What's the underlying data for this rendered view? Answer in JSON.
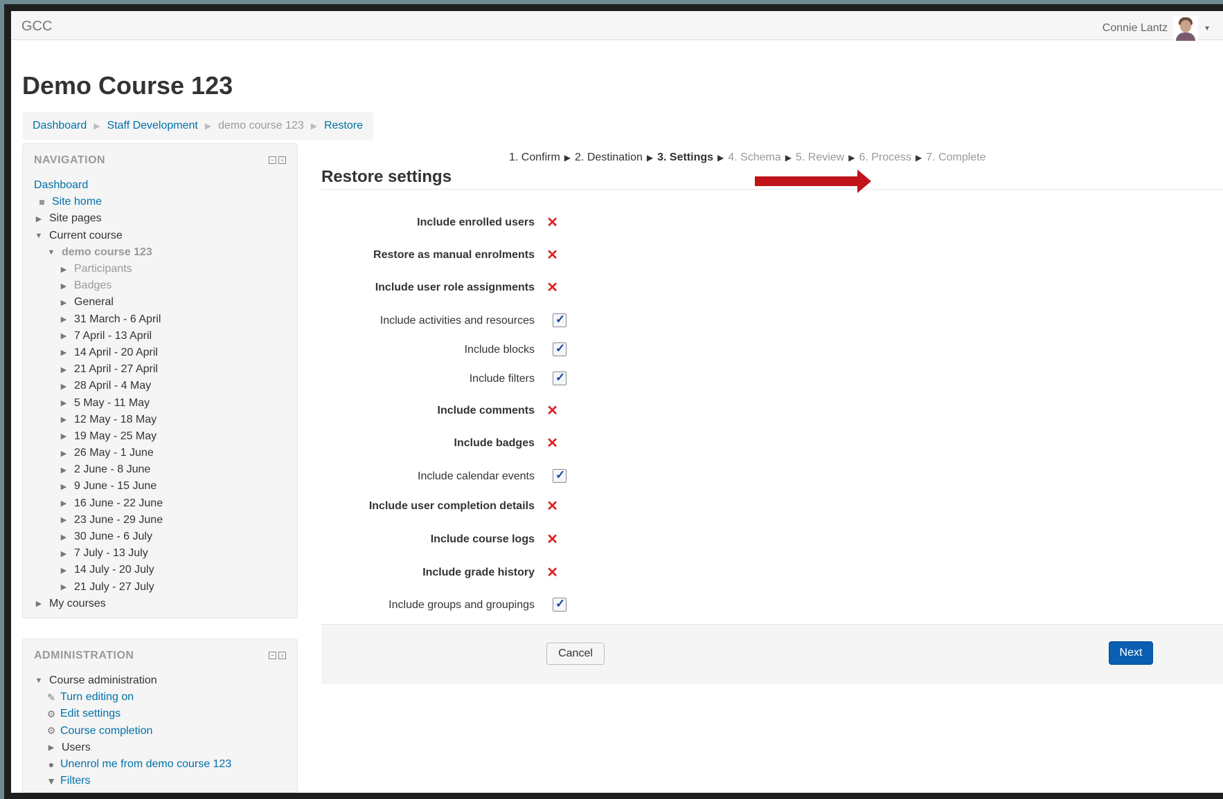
{
  "topbar": {
    "brand": "GCC",
    "user_name": "Connie Lantz"
  },
  "page": {
    "title": "Demo Course 123"
  },
  "breadcrumb": [
    {
      "label": "Dashboard",
      "current": false
    },
    {
      "label": "Staff Development",
      "current": false
    },
    {
      "label": "demo course 123",
      "current": true
    },
    {
      "label": "Restore",
      "current": false
    }
  ],
  "steps": [
    {
      "label": "1. Confirm",
      "state": "done"
    },
    {
      "label": "2. Destination",
      "state": "done"
    },
    {
      "label": "3. Settings",
      "state": "active"
    },
    {
      "label": "4. Schema",
      "state": "future"
    },
    {
      "label": "5. Review",
      "state": "future"
    },
    {
      "label": "6. Process",
      "state": "future"
    },
    {
      "label": "7. Complete",
      "state": "future"
    }
  ],
  "restore": {
    "title": "Restore settings",
    "settings": [
      {
        "label": "Include enrolled users",
        "enabled": false
      },
      {
        "label": "Restore as manual enrolments",
        "enabled": false
      },
      {
        "label": "Include user role assignments",
        "enabled": false
      },
      {
        "label": "Include activities and resources",
        "enabled": true
      },
      {
        "label": "Include blocks",
        "enabled": true
      },
      {
        "label": "Include filters",
        "enabled": true
      },
      {
        "label": "Include comments",
        "enabled": false
      },
      {
        "label": "Include badges",
        "enabled": false
      },
      {
        "label": "Include calendar events",
        "enabled": true
      },
      {
        "label": "Include user completion details",
        "enabled": false
      },
      {
        "label": "Include course logs",
        "enabled": false
      },
      {
        "label": "Include grade history",
        "enabled": false
      },
      {
        "label": "Include groups and groupings",
        "enabled": true
      }
    ],
    "cancel_label": "Cancel",
    "next_label": "Next"
  },
  "navigation": {
    "title": "NAVIGATION",
    "dashboard": "Dashboard",
    "site_home": "Site home",
    "site_pages": "Site pages",
    "current_course": "Current course",
    "course": "demo course 123",
    "participants": "Participants",
    "badges": "Badges",
    "general": "General",
    "weeks": [
      "31 March - 6 April",
      "7 April - 13 April",
      "14 April - 20 April",
      "21 April - 27 April",
      "28 April - 4 May",
      "5 May - 11 May",
      "12 May - 18 May",
      "19 May - 25 May",
      "26 May - 1 June",
      "2 June - 8 June",
      "9 June - 15 June",
      "16 June - 22 June",
      "23 June - 29 June",
      "30 June - 6 July",
      "7 July - 13 July",
      "14 July - 20 July",
      "21 July - 27 July"
    ],
    "my_courses": "My courses"
  },
  "administration": {
    "title": "ADMINISTRATION",
    "course_admin": "Course administration",
    "turn_editing": "Turn editing on",
    "edit_settings": "Edit settings",
    "course_completion": "Course completion",
    "users": "Users",
    "unenrol": "Unenrol me from demo course 123",
    "filters": "Filters"
  },
  "colors": {
    "link": "#0070a8",
    "next_button": "#0a5fb3",
    "cross": "#e02020",
    "annotation_arrow": "#c0141a"
  },
  "icons": {
    "enabled": "checkbox-checked-icon",
    "disabled": "red-cross-icon"
  }
}
